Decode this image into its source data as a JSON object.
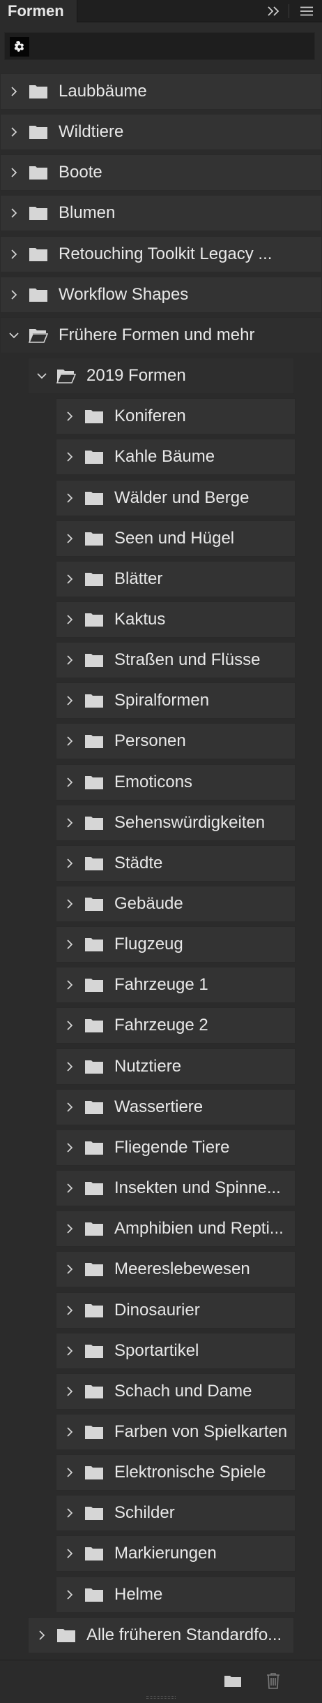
{
  "panel": {
    "tab_label": "Formen",
    "colors": {
      "background": "#2b2b2b",
      "row": "#333333",
      "text": "#e8e8e8",
      "icon": "#d6d6d6"
    }
  },
  "icons": {
    "collapse": "double-chevron-right-icon",
    "menu": "hamburger-menu-icon",
    "folder": "folder-icon",
    "open_folder": "open-folder-icon",
    "new_folder": "new-folder-icon",
    "delete": "trash-icon"
  },
  "tree": {
    "top_level": [
      {
        "label": "Laubbäume",
        "expanded": false
      },
      {
        "label": "Wildtiere",
        "expanded": false
      },
      {
        "label": "Boote",
        "expanded": false
      },
      {
        "label": "Blumen",
        "expanded": false
      },
      {
        "label": "Retouching Toolkit Legacy ...",
        "expanded": false
      },
      {
        "label": "Workflow Shapes",
        "expanded": false
      },
      {
        "label": "Frühere Formen und mehr",
        "expanded": true
      }
    ],
    "group_2019": {
      "label": "2019 Formen",
      "expanded": true
    },
    "sub_items": [
      "Koniferen",
      "Kahle Bäume",
      "Wälder und Berge",
      "Seen und Hügel",
      "Blätter",
      "Kaktus",
      "Straßen und Flüsse",
      "Spiralformen",
      "Personen",
      "Emoticons",
      "Sehenswürdigkeiten",
      "Städte",
      "Gebäude",
      "Flugzeug",
      "Fahrzeuge 1",
      "Fahrzeuge 2",
      "Nutztiere",
      "Wassertiere",
      "Fliegende Tiere",
      "Insekten und Spinne...",
      "Amphibien und Repti...",
      "Meereslebewesen",
      "Dinosaurier",
      "Sportartikel",
      "Schach und Dame",
      "Farben von Spielkarten",
      "Elektronische Spiele",
      "Schilder",
      "Markierungen",
      "Helme"
    ],
    "legacy_all": {
      "label": "Alle früheren Standardfo...",
      "expanded": false
    }
  }
}
